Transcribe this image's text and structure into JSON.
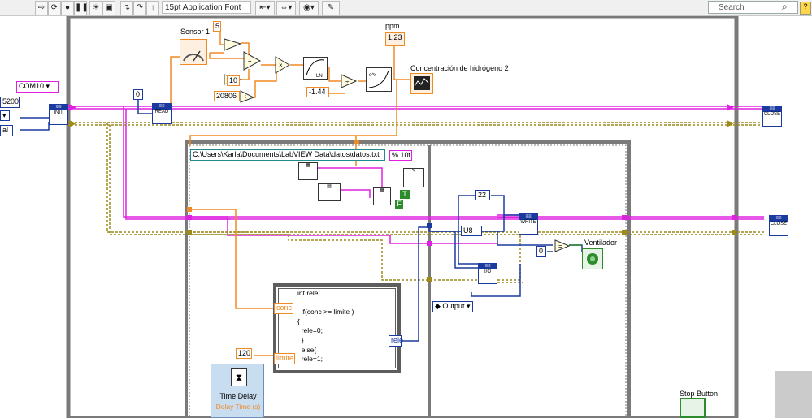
{
  "toolbar": {
    "font_select": "15pt Application Font",
    "search_placeholder": "Search",
    "help": "?"
  },
  "left_controls": {
    "com_port": "COM10",
    "baud": "5200",
    "stop_partial": "al"
  },
  "constants": {
    "five": "5",
    "ten": "10",
    "c20806": "20806",
    "neg144": "-1.44",
    "zero_a": "0",
    "zero_b": "0",
    "twentytwo": "22",
    "onetwenty": "120",
    "format": "%.10f",
    "path": "C:\\Users\\Karla\\Documents\\LabVIEW Data\\datos\\datos.txt",
    "u8": "U8"
  },
  "labels": {
    "sensor1": "Sensor 1",
    "ppm": "ppm",
    "ppm_value": "1.23",
    "concentracion": "Concentración de hidrógeno 2",
    "ventilador": "Ventilador",
    "stop_button": "Stop Button",
    "output": "Output",
    "conc": "conc",
    "limite": "limite",
    "rele": "rele",
    "time_delay": "Time Delay",
    "delay_time": "Delay Time (s)"
  },
  "formula_code": "int rele;\n\n  if(conc >= limite )\n{\n  rele=0;\n  }\n  else{\n  rele=1;",
  "visa_nodes": {
    "init": "INIT",
    "read": "READ",
    "write": "WRITE",
    "io": "I/O",
    "close1": "CLOSE",
    "close2": "CLOSE"
  },
  "colors": {
    "pink_wire": "#e020e0",
    "orange_wire": "#f08a24",
    "blue_wire": "#1b3aa0",
    "error_wire": "#9c8a1a",
    "structure_gray": "#7a7a7a"
  }
}
